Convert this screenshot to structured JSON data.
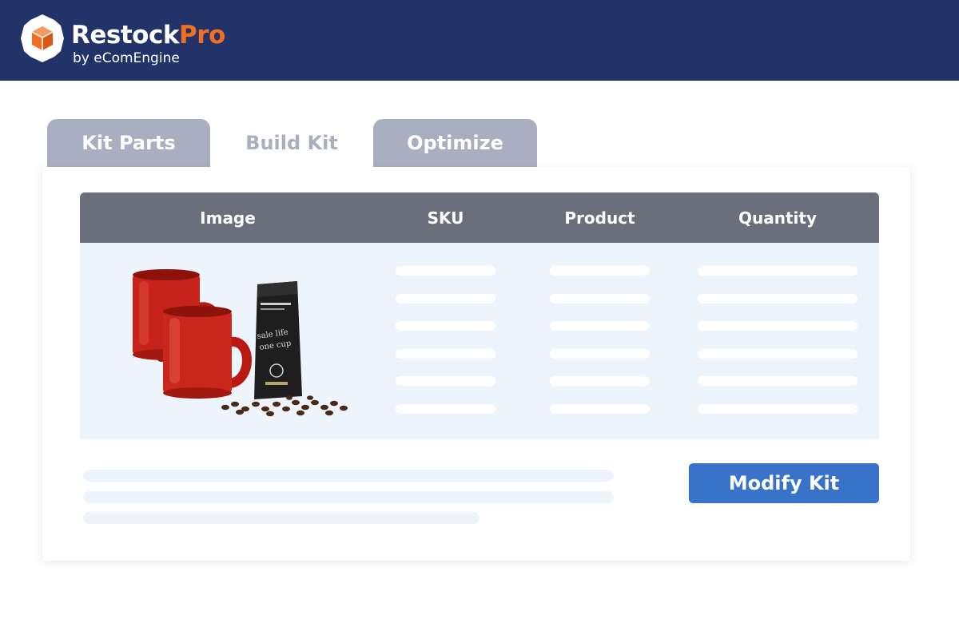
{
  "header": {
    "brand_main": "Restock",
    "brand_accent": "Pro",
    "tagline": "by eComEngine",
    "logo_icon": "restockpro-logo-icon"
  },
  "tabs": [
    {
      "label": "Kit Parts",
      "active": false
    },
    {
      "label": "Build Kit",
      "active": true
    },
    {
      "label": "Optimize",
      "active": false
    }
  ],
  "table": {
    "columns": [
      "Image",
      "SKU",
      "Product",
      "Quantity"
    ],
    "row_image": "mugs-and-coffee-bag-image"
  },
  "actions": {
    "modify_label": "Modify Kit"
  },
  "colors": {
    "header_bg": "#22336a",
    "accent": "#f26f21",
    "tab_inactive": "#a9afc0",
    "table_head": "#6b6f7c",
    "table_body": "#eef4fc",
    "button": "#3873c9"
  }
}
